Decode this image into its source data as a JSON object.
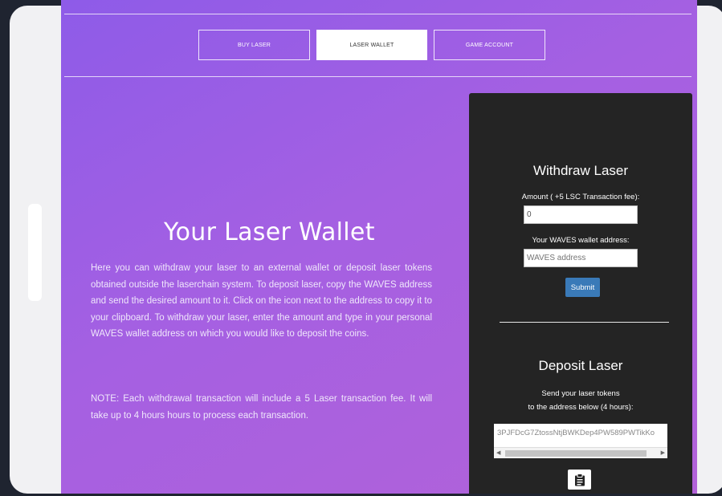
{
  "nav": {
    "buy_laser": "BUY LASER",
    "laser_wallet": "LASER WALLET",
    "game_account": "GAME ACCOUNT"
  },
  "main": {
    "title": "Your Laser Wallet",
    "description": "Here you can withdraw your laser to an external wallet or deposit laser tokens obtained outside the laserchain system. To deposit laser, copy the WAVES address and send the desired amount to it. Click on the icon next to the address to copy it to your clipboard. To withdraw your laser, enter the amount and type in your personal WAVES wallet address on which you would like to deposit the coins.",
    "note": "NOTE: Each withdrawal transaction will include a 5 Laser transaction fee. It will take up to 4 hours hours to process each transaction."
  },
  "withdraw": {
    "title": "Withdraw Laser",
    "amount_label": "Amount ( +5 LSC Transaction fee):",
    "amount_value": "0",
    "address_label": "Your WAVES wallet address:",
    "address_placeholder": "WAVES address",
    "submit_label": "Submit"
  },
  "deposit": {
    "title": "Deposit Laser",
    "line1": "Send your laser tokens",
    "line2": "to the address below (4 hours):",
    "address": "3PJFDcG7ZtossNtjBWKDep4PW589PWTikKo"
  },
  "icons": {
    "clipboard": "clipboard-icon",
    "scroll_left": "arrow-left-icon",
    "scroll_right": "arrow-right-icon"
  },
  "colors": {
    "gradient_start": "#8e5be8",
    "gradient_end": "#b262d8",
    "panel_bg": "#242424",
    "submit_bg": "#3a7ab8"
  }
}
